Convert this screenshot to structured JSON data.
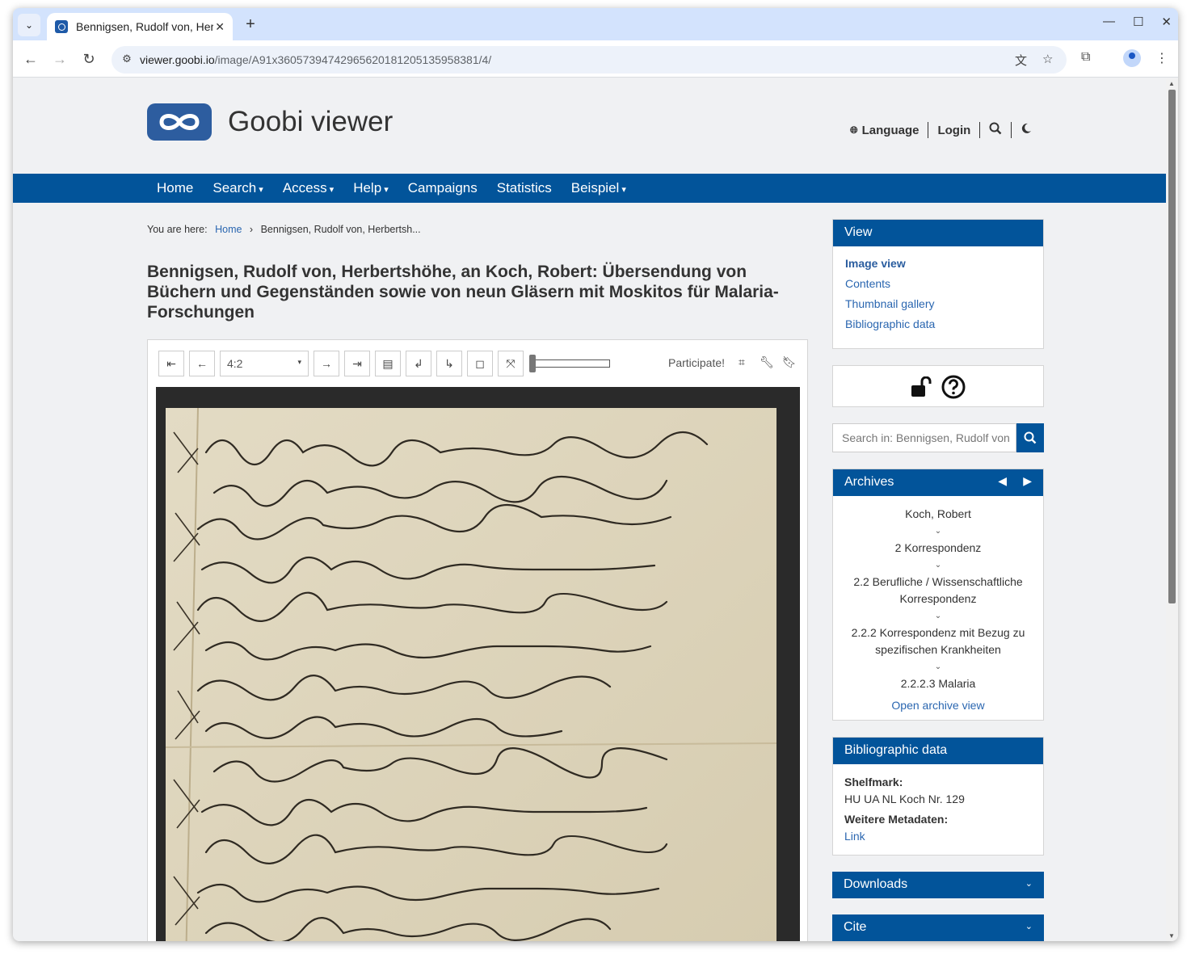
{
  "browser": {
    "tab_title": "Bennigsen, Rudolf von, Herbertshöhe, an Koch, Robert",
    "new_tab": "+",
    "url_host": "viewer.goobi.io",
    "url_path": "/image/A91x36057394742965620181205135958381/4/",
    "window_controls": [
      "—",
      "☐",
      "✕"
    ]
  },
  "header": {
    "logo_text": "Goobi viewer",
    "language": "Language",
    "login": "Login"
  },
  "nav": {
    "items": [
      {
        "label": "Home",
        "dropdown": false
      },
      {
        "label": "Search",
        "dropdown": true
      },
      {
        "label": "Access",
        "dropdown": true
      },
      {
        "label": "Help",
        "dropdown": true
      },
      {
        "label": "Campaigns",
        "dropdown": false
      },
      {
        "label": "Statistics",
        "dropdown": false
      },
      {
        "label": "Beispiel",
        "dropdown": true
      }
    ]
  },
  "breadcrumb": {
    "prefix": "You are here:",
    "home": "Home",
    "separator": "›",
    "current": "Bennigsen, Rudolf von, Herbertsh..."
  },
  "document": {
    "title": "Bennigsen, Rudolf von, Herbertshöhe, an Koch, Robert: Übersendung von Büchern und Gegenständen sowie von neun Gläsern mit Moskitos für Malaria-Forschungen"
  },
  "viewer": {
    "page_select": "4:2",
    "participate": "Participate!",
    "zoom_level": 0.05
  },
  "sidebar": {
    "view": {
      "title": "View",
      "links": [
        "Image view",
        "Contents",
        "Thumbnail gallery",
        "Bibliographic data"
      ],
      "active": "Image view"
    },
    "search_placeholder": "Search in: Bennigsen, Rudolf von",
    "archives": {
      "title": "Archives",
      "hierarchy": [
        "Koch, Robert",
        "2 Korrespondenz",
        "2.2 Berufliche / Wissenschaftliche Korrespondenz",
        "2.2.2 Korrespondenz mit Bezug zu spezifischen Krankheiten",
        "2.2.2.3 Malaria"
      ],
      "open_link": "Open archive view"
    },
    "bibliographic": {
      "title": "Bibliographic data",
      "shelfmark_label": "Shelfmark:",
      "shelfmark_value": "HU UA NL Koch Nr. 129",
      "meta_label": "Weitere Metadaten:",
      "meta_link": "Link"
    },
    "downloads": "Downloads",
    "cite": "Cite"
  },
  "colors": {
    "brand_blue": "#02549a",
    "link_blue": "#2a66b0",
    "page_bg": "#f0f1f3"
  }
}
